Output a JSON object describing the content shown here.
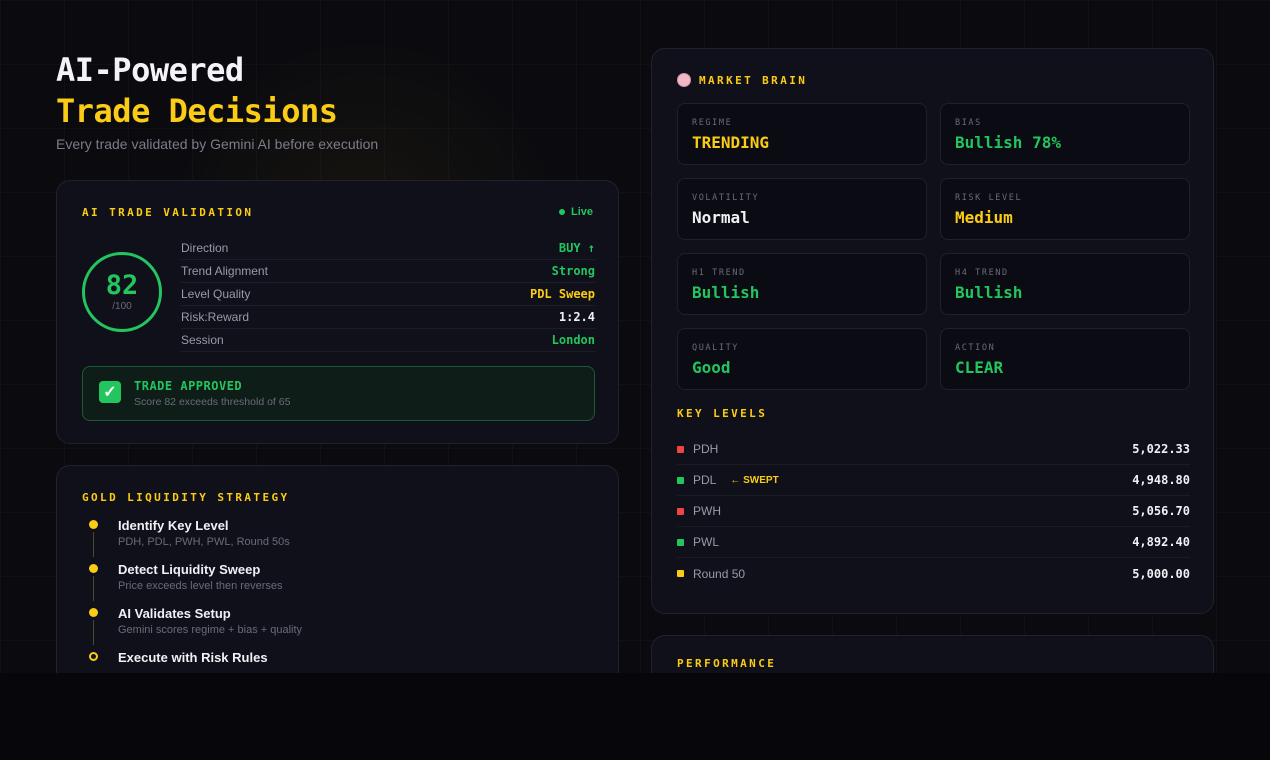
{
  "hero": {
    "title_line1": "AI-Powered",
    "title_line2": "Trade Decisions",
    "subtitle": "Every trade validated by Gemini AI before execution"
  },
  "validation": {
    "label": "AI TRADE VALIDATION",
    "live_label": "Live",
    "score": "82",
    "score_max": "/100",
    "metrics": [
      {
        "key": "Direction",
        "value": "BUY ↑",
        "color": "#22c55e"
      },
      {
        "key": "Trend Alignment",
        "value": "Strong",
        "color": "#22c55e"
      },
      {
        "key": "Level Quality",
        "value": "PDL Sweep",
        "color": "#facc15"
      },
      {
        "key": "Risk:Reward",
        "value": "1:2.4",
        "color": "#f0f0f5"
      },
      {
        "key": "Session",
        "value": "London",
        "color": "#22c55e"
      }
    ],
    "approved_title": "TRADE APPROVED",
    "approved_text": "Score 82 exceeds threshold of 65"
  },
  "strategy": {
    "label": "GOLD LIQUIDITY STRATEGY",
    "steps": [
      {
        "title": "Identify Key Level",
        "desc": "PDH, PDL, PWH, PWL, Round 50s"
      },
      {
        "title": "Detect Liquidity Sweep",
        "desc": "Price exceeds level then reverses"
      },
      {
        "title": "AI Validates Setup",
        "desc": "Gemini scores regime + bias + quality"
      },
      {
        "title": "Execute with Risk Rules",
        "desc": ""
      }
    ]
  },
  "brain": {
    "label": "MARKET BRAIN",
    "icon": "brain-icon",
    "tiles": [
      {
        "label": "REGIME",
        "value": "TRENDING",
        "color": "#facc15"
      },
      {
        "label": "BIAS",
        "value": "Bullish 78%",
        "color": "#22c55e"
      },
      {
        "label": "VOLATILITY",
        "value": "Normal",
        "color": "#f0f0f5"
      },
      {
        "label": "RISK LEVEL",
        "value": "Medium",
        "color": "#facc15"
      },
      {
        "label": "H1 TREND",
        "value": "Bullish",
        "color": "#22c55e"
      },
      {
        "label": "H4 TREND",
        "value": "Bullish",
        "color": "#22c55e"
      },
      {
        "label": "QUALITY",
        "value": "Good",
        "color": "#22c55e"
      },
      {
        "label": "ACTION",
        "value": "CLEAR",
        "color": "#22c55e"
      }
    ],
    "key_levels_label": "KEY LEVELS",
    "levels": [
      {
        "name": "PDH",
        "value": "5,022.33",
        "color": "#ef4444",
        "tag": ""
      },
      {
        "name": "PDL",
        "value": "4,948.80",
        "color": "#22c55e",
        "tag": "← SWEPT"
      },
      {
        "name": "PWH",
        "value": "5,056.70",
        "color": "#ef4444",
        "tag": ""
      },
      {
        "name": "PWL",
        "value": "4,892.40",
        "color": "#22c55e",
        "tag": ""
      },
      {
        "name": "Round 50",
        "value": "5,000.00",
        "color": "#facc15",
        "tag": ""
      }
    ]
  },
  "performance": {
    "label": "PERFORMANCE"
  }
}
